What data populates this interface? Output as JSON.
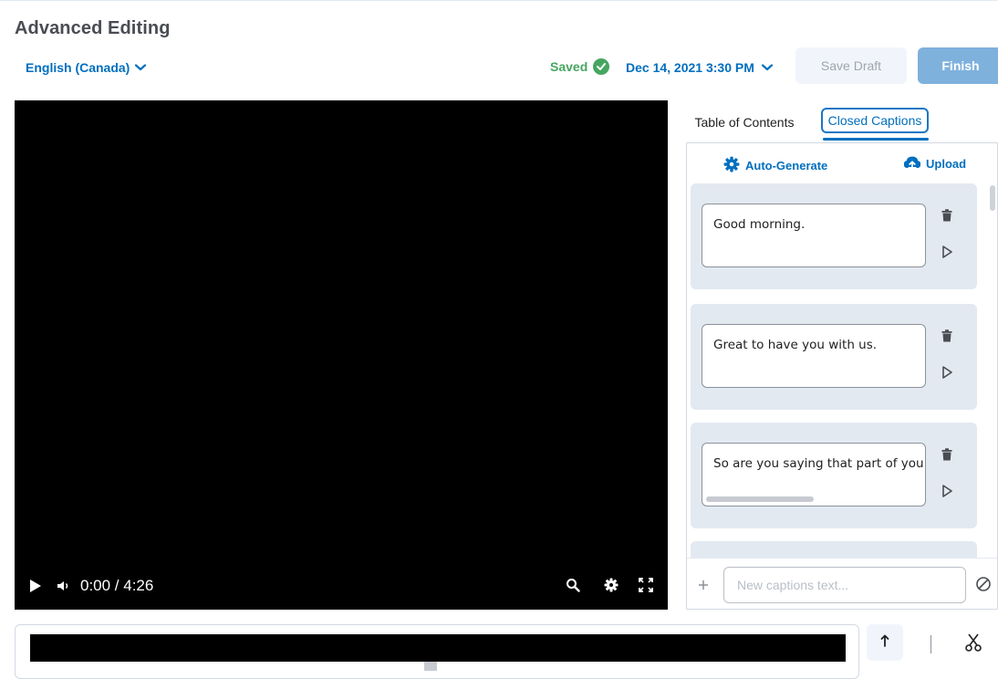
{
  "header": {
    "title": "Advanced Editing",
    "language": "English (Canada)",
    "status": "Saved",
    "datetime": "Dec 14, 2021 3:30 PM",
    "save_draft_label": "Save Draft",
    "finish_label": "Finish"
  },
  "player": {
    "time": "0:00 / 4:26",
    "icons": [
      "play-icon",
      "volume-icon",
      "search-icon",
      "gear-icon",
      "fullscreen-icon"
    ]
  },
  "tabs": {
    "toc_label": "Table of Contents",
    "cc_label": "Closed Captions",
    "active": "Closed Captions"
  },
  "captions_panel": {
    "auto_generate_label": "Auto-Generate",
    "upload_label": "Upload",
    "items": [
      {
        "text": "Good morning."
      },
      {
        "text": "Great to have you with us."
      },
      {
        "text": "So are you saying that part of you"
      }
    ],
    "new_caption_placeholder": "New captions text..."
  },
  "colors": {
    "accent": "#006fbf",
    "finish_button": "#7fb1dd",
    "saved_green": "#46a661",
    "card_bg": "#e3e9f1"
  }
}
